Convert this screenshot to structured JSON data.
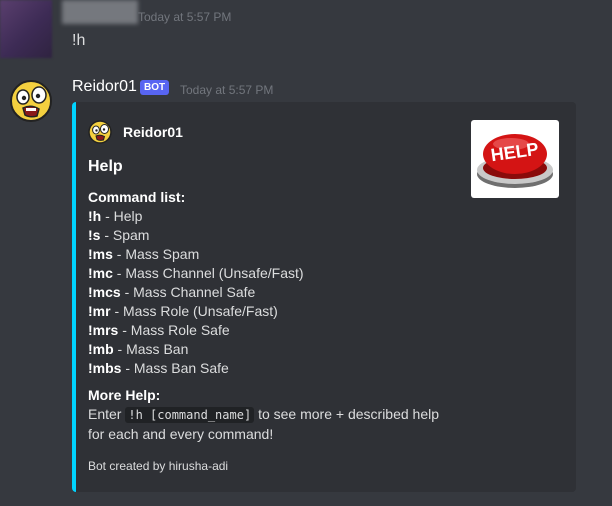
{
  "first_message": {
    "timestamp": "Today at 5:57 PM",
    "text": "!h"
  },
  "bot_message": {
    "username": "Reidor01",
    "badge": "BOT",
    "timestamp": "Today at 5:57 PM",
    "embed": {
      "accent_color": "#00d4ff",
      "author": "Reidor01",
      "title": "Help",
      "thumbnail_icon": "help-button-icon",
      "thumbnail_text": "HELP",
      "command_list_heading": "Command list:",
      "commands": [
        {
          "cmd": "!h",
          "desc": " - Help"
        },
        {
          "cmd": "!s",
          "desc": " - Spam"
        },
        {
          "cmd": "!ms",
          "desc": " - Mass Spam"
        },
        {
          "cmd": "!mc",
          "desc": " - Mass Channel (Unsafe/Fast)"
        },
        {
          "cmd": "!mcs",
          "desc": " - Mass Channel Safe"
        },
        {
          "cmd": "!mr",
          "desc": " - Mass Role (Unsafe/Fast)"
        },
        {
          "cmd": "!mrs",
          "desc": " - Mass Role Safe"
        },
        {
          "cmd": "!mb",
          "desc": " - Mass Ban"
        },
        {
          "cmd": "!mbs",
          "desc": " - Mass Ban Safe"
        }
      ],
      "more_help_heading": "More Help:",
      "more_help_prefix": "Enter ",
      "more_help_code": "!h [command_name]",
      "more_help_suffix": " to see more + described help",
      "more_help_line2": "for each and every command!",
      "footer": "Bot created by hirusha-adi"
    }
  }
}
